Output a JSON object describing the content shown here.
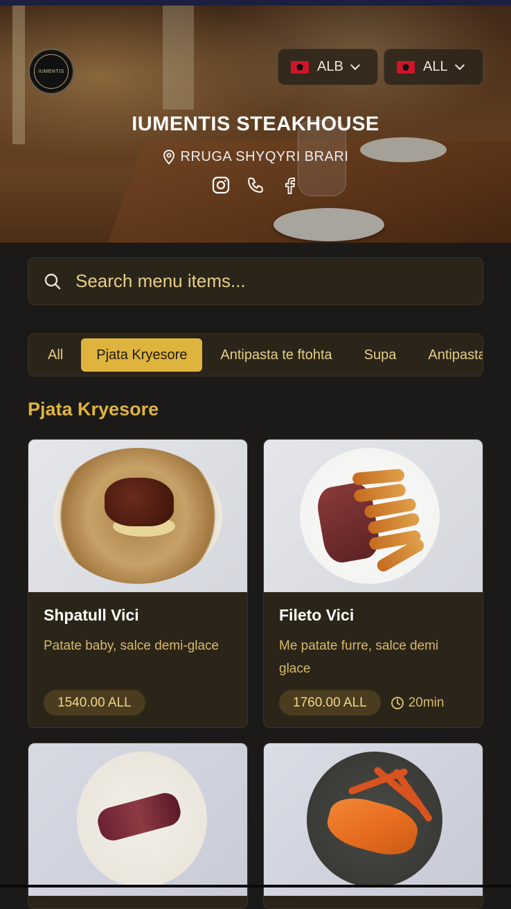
{
  "header": {
    "restaurant_name": "IUMENTIS STEAKHOUSE",
    "address": "RRUGA SHYQYRI BRARI",
    "logo_text": "IUMENTIS",
    "language_selector": {
      "value": "ALB",
      "icon": "albania-flag-icon"
    },
    "currency_selector": {
      "value": "ALL",
      "icon": "albania-flag-icon"
    },
    "social": [
      "instagram-icon",
      "phone-icon",
      "facebook-icon"
    ]
  },
  "search": {
    "placeholder": "Search menu items..."
  },
  "categories": {
    "tabs": [
      {
        "label": "All",
        "active": false
      },
      {
        "label": "Pjata Kryesore",
        "active": true
      },
      {
        "label": "Antipasta te ftohta",
        "active": false
      },
      {
        "label": "Supa",
        "active": false
      },
      {
        "label": "Antipasta",
        "active": false
      }
    ]
  },
  "section": {
    "title": "Pjata Kryesore"
  },
  "items": [
    {
      "name": "Shpatull Vici",
      "description": "Patate baby, salce demi-glace",
      "price": "1540.00 ALL",
      "time": ""
    },
    {
      "name": "Fileto Vici",
      "description": "Me patate furre, salce demi glace",
      "price": "1760.00 ALL",
      "time": "20min"
    },
    {
      "name": "",
      "description": "",
      "price": "",
      "time": ""
    },
    {
      "name": "",
      "description": "",
      "price": "",
      "time": ""
    }
  ],
  "colors": {
    "accent": "#dfb43e",
    "background": "#1b1a19",
    "card": "#2b2519"
  }
}
